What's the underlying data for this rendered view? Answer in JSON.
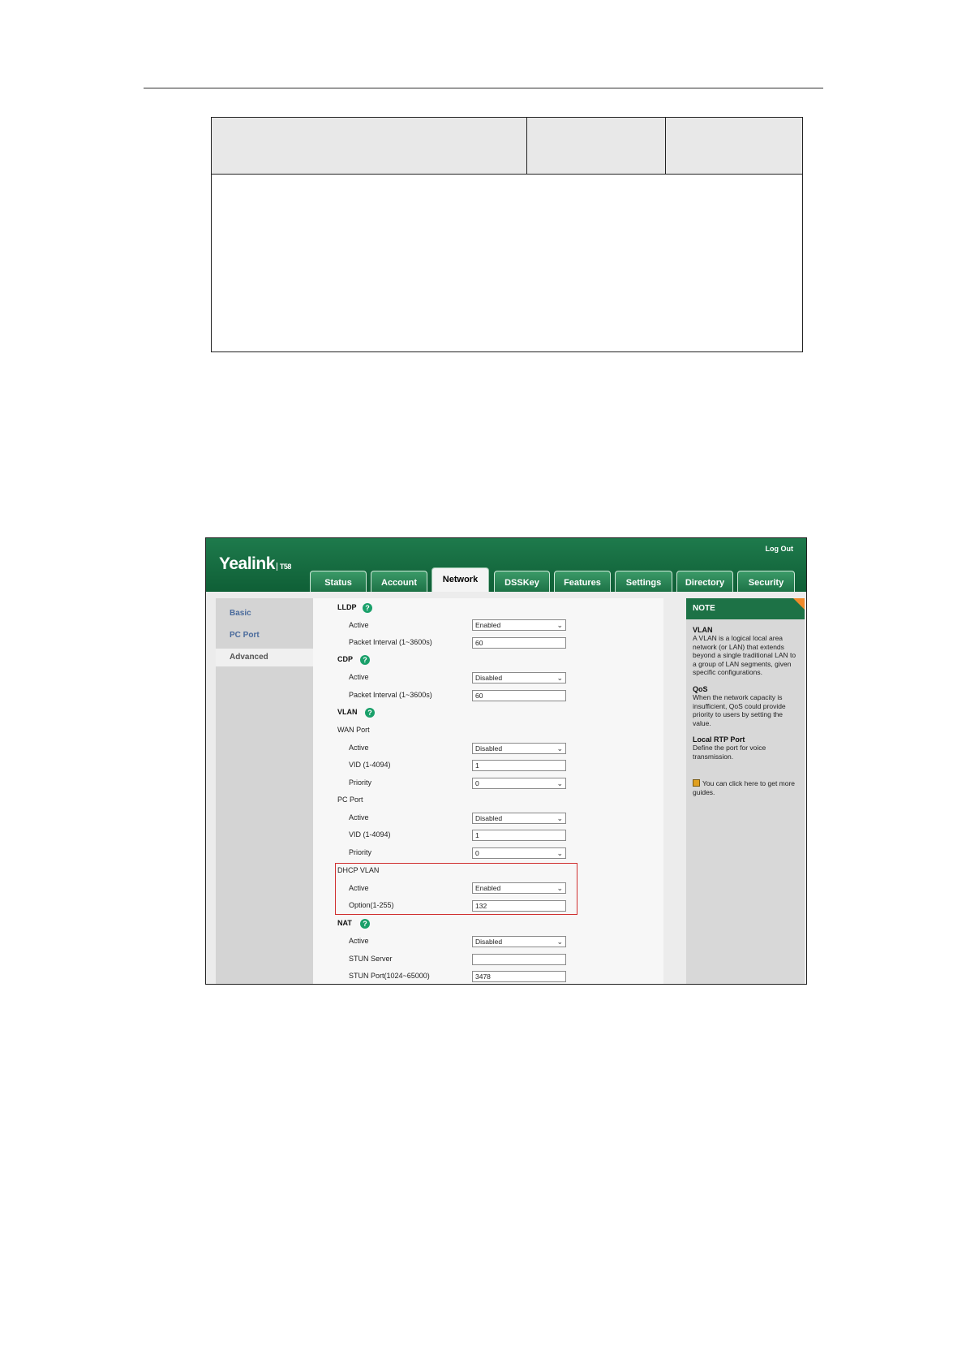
{
  "web_ui": {
    "brand": "Yealink",
    "model": "T58",
    "logout_label": "Log Out",
    "tabs": [
      {
        "label": "Status"
      },
      {
        "label": "Account"
      },
      {
        "label": "Network",
        "active": true
      },
      {
        "label": "DSSKey"
      },
      {
        "label": "Features"
      },
      {
        "label": "Settings"
      },
      {
        "label": "Directory"
      },
      {
        "label": "Security"
      }
    ],
    "sidebar": [
      "Basic",
      "PC Port",
      "Advanced"
    ],
    "sidebar_active": "Advanced",
    "form": {
      "lldp": {
        "title": "LLDP",
        "active_label": "Active",
        "active_value": "Enabled",
        "interval_label": "Packet Interval (1~3600s)",
        "interval_value": "60"
      },
      "cdp": {
        "title": "CDP",
        "active_label": "Active",
        "active_value": "Disabled",
        "interval_label": "Packet Interval (1~3600s)",
        "interval_value": "60"
      },
      "vlan": {
        "title": "VLAN",
        "wan_port_label": "WAN Port",
        "wan_active_label": "Active",
        "wan_active_value": "Disabled",
        "wan_vid_label": "VID (1-4094)",
        "wan_vid_value": "1",
        "wan_priority_label": "Priority",
        "wan_priority_value": "0",
        "pc_port_label": "PC Port",
        "pc_active_label": "Active",
        "pc_active_value": "Disabled",
        "pc_vid_label": "VID (1-4094)",
        "pc_vid_value": "1",
        "pc_priority_label": "Priority",
        "pc_priority_value": "0"
      },
      "dhcp_vlan": {
        "title": "DHCP VLAN",
        "active_label": "Active",
        "active_value": "Enabled",
        "option_label": "Option(1-255)",
        "option_value": "132"
      },
      "nat": {
        "title": "NAT",
        "active_label": "Active",
        "active_value": "Disabled",
        "stun_server_label": "STUN Server",
        "stun_server_value": "",
        "stun_port_label": "STUN Port(1024~65000)",
        "stun_port_value": "3478"
      }
    },
    "help_glyph": "?",
    "dropdown_glyph": "⌄",
    "note": {
      "header": "NOTE",
      "vlan_title": "VLAN",
      "vlan_text": "A VLAN is a logical local area network (or LAN) that extends beyond a single traditional LAN to a group of LAN segments, given specific configurations.",
      "qos_title": "QoS",
      "qos_text": "When the network capacity is insufficient, QoS could provide priority to users by setting the value.",
      "rtp_title": "Local RTP Port",
      "rtp_text": "Define the port for voice transmission.",
      "guide_text": "You can click here to get more guides."
    },
    "colors": {
      "banner": "#1e7a4c",
      "highlight_box": "#d03030",
      "help_icon": "#1aa06a",
      "note_corner": "#f08a2a"
    }
  }
}
